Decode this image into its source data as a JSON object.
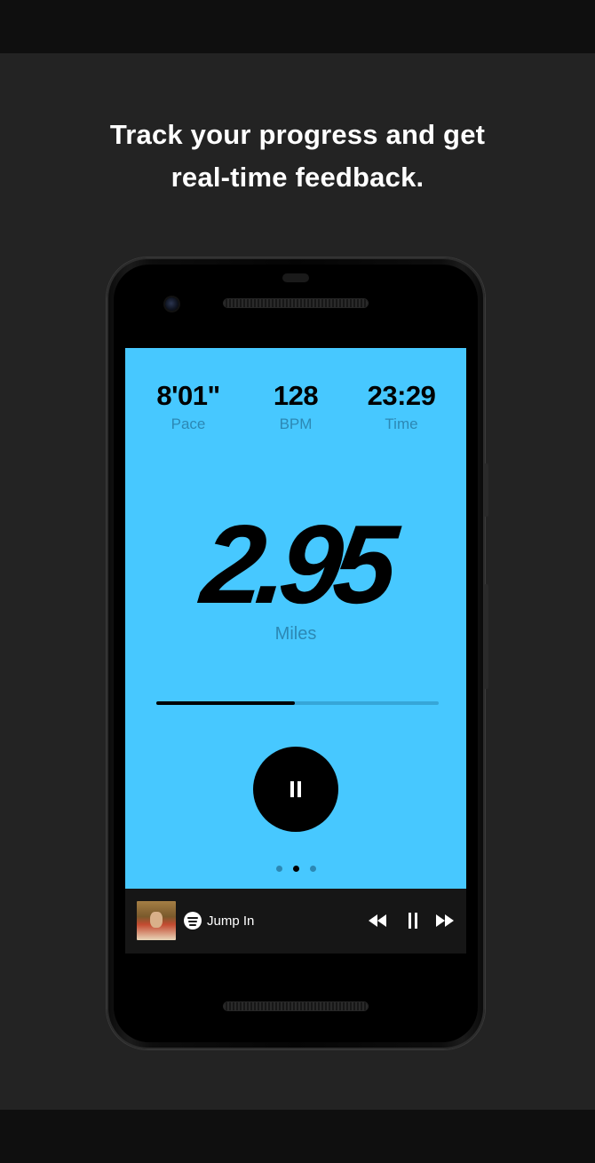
{
  "headline": {
    "line1": "Track your progress and get",
    "line2": "real-time feedback."
  },
  "stats": {
    "pace": {
      "value": "8'01\"",
      "label": "Pace"
    },
    "bpm": {
      "value": "128",
      "label": "BPM"
    },
    "time": {
      "value": "23:29",
      "label": "Time"
    }
  },
  "distance": {
    "value": "2.95",
    "unit": "Miles"
  },
  "progress": {
    "fraction": 0.49
  },
  "pager": {
    "count": 3,
    "active_index": 1
  },
  "music": {
    "provider_icon": "spotify-icon",
    "track": "Jump In"
  },
  "colors": {
    "screen": "#47c8ff",
    "label": "#2c88b4",
    "panel": "#232323"
  }
}
